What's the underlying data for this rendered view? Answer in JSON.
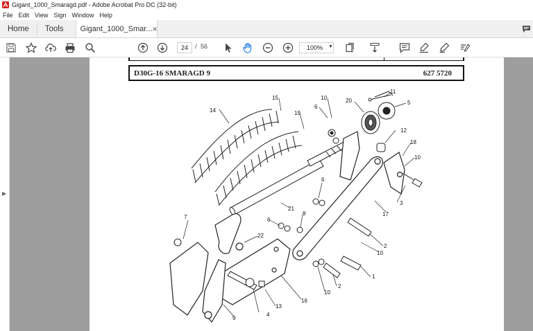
{
  "window": {
    "title": "Gigant_1000_Smaragd.pdf - Adobe Acrobat Pro DC (32-bit)"
  },
  "menu": {
    "items": [
      "File",
      "Edit",
      "View",
      "Sign",
      "Window",
      "Help"
    ]
  },
  "tabs": {
    "home": "Home",
    "tools": "Tools",
    "document": "Gigant_1000_Smar...",
    "close": "×"
  },
  "toolbar": {
    "current_page": "24",
    "separator": "/",
    "total_pages": "56",
    "zoom": "100%"
  },
  "document": {
    "model": "D30G-16 SMARAGD 9",
    "part_number": "627 5720",
    "callouts": {
      "c1": "1",
      "c2a": "2",
      "c2b": "2",
      "c3": "3",
      "c4": "4",
      "c5": "5",
      "c6a": "6",
      "c6b": "6",
      "c6c": "6",
      "c7": "7",
      "c8": "8",
      "c9": "9",
      "c10a": "10",
      "c10b": "10",
      "c10c": "10",
      "c10d": "10",
      "c11": "11",
      "c12": "12",
      "c13": "13",
      "c14": "14",
      "c15": "15",
      "c16": "16",
      "c17": "17",
      "c18": "18",
      "c19": "19",
      "c20": "20",
      "c21": "21",
      "c22": "22"
    }
  }
}
